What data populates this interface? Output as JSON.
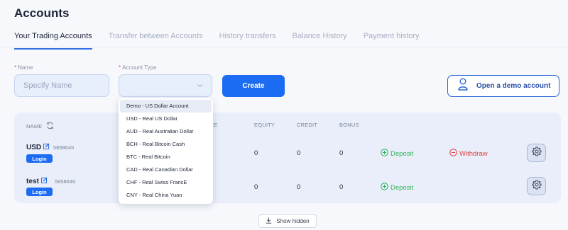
{
  "page": {
    "title": "Accounts"
  },
  "tabs": [
    {
      "label": "Your Trading Accounts",
      "active": true
    },
    {
      "label": "Transfer between Accounts",
      "active": false
    },
    {
      "label": "History transfers",
      "active": false
    },
    {
      "label": "Balance History",
      "active": false
    },
    {
      "label": "Payment history",
      "active": false
    }
  ],
  "form": {
    "name_label": "Name",
    "name_placeholder": "Specify Name",
    "type_label": "Account Type",
    "required_mark": "*",
    "create_label": "Create",
    "demo_label": "Open a demo account"
  },
  "account_type_options": [
    "Demo - US Dollar Account",
    "USD - Real US Dollar",
    "AUD - Real Australian Dollar",
    "BCH - Real Bitcoin Cash",
    "BTC - Real Bitcoin",
    "CAD - Real Canadian Dollar",
    "CHF - Real Swiss FrancE",
    "CNY - Real China Yuan"
  ],
  "table": {
    "headers": {
      "name": "NAME",
      "balance": "ANCE",
      "equity": "EQUITY",
      "credit": "CREDIT",
      "bonus": "BONUS"
    },
    "rows": [
      {
        "name": "USD",
        "number": "5858645",
        "login": "Login",
        "equity": "0",
        "credit": "0",
        "bonus": "0",
        "deposit": "Deposit",
        "withdraw": "Withdraw"
      },
      {
        "name": "test",
        "number": "5858646",
        "login": "Login",
        "equity": "0",
        "credit": "0",
        "bonus": "0",
        "deposit": "Deposit"
      }
    ]
  },
  "show_hidden_label": "Show hidden",
  "colors": {
    "primary": "#1b6cf2",
    "deposit": "#2fb35a",
    "withdraw": "#e0403d",
    "panel": "#e9eefa"
  }
}
